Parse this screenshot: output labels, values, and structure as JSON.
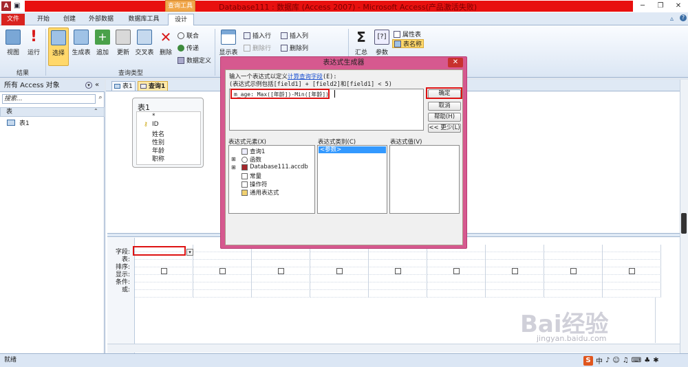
{
  "title_bar": {
    "context_tab": "查询工具",
    "window_title": "Database111 : 数据库 (Access 2007) - Microsoft Access(产品激活失败)"
  },
  "tabs": [
    "文件",
    "开始",
    "创建",
    "外部数据",
    "数据库工具",
    "设计"
  ],
  "ribbon": {
    "results_group": {
      "label": "结果",
      "view": "视图",
      "run": "运行"
    },
    "query_type_group": {
      "label": "查询类型",
      "select": "选择",
      "make_table": "生成表",
      "append": "追加",
      "update": "更新",
      "crosstab": "交叉表",
      "delete": "删除",
      "union": "联合",
      "pass_through": "传递",
      "data_definition": "数据定义"
    },
    "show_table": "显示表",
    "insert_row": "插入行",
    "delete_row": "删除行",
    "insert_col": "插入列",
    "delete_col": "删除列",
    "totals": "汇总",
    "parameters": "参数",
    "property_sheet": "属性表",
    "table_names": "表名称"
  },
  "nav": {
    "header": "所有 Access 对象",
    "search_placeholder": "搜索...",
    "section": "表",
    "items": [
      "表1"
    ]
  },
  "doc_tabs": [
    "表1",
    "查询1"
  ],
  "table_box": {
    "title": "表1",
    "fields": [
      "*",
      "ID",
      "姓名",
      "性别",
      "年龄",
      "职称"
    ]
  },
  "grid": {
    "row_labels": [
      "字段:",
      "表:",
      "排序:",
      "显示:",
      "条件:",
      "或:"
    ]
  },
  "dialog": {
    "title": "表达式生成器",
    "instruction_prefix": "输入一个表达式以定义",
    "instruction_link": "计算查询字段",
    "instruction_suffix": "(E):",
    "example": "(表达式示例包括[field1] + [field2]和[field1] < 5)",
    "expression": "m_age: Max([年龄])-Min([年龄])",
    "buttons": {
      "ok": "确定",
      "cancel": "取消",
      "help": "帮助(H)",
      "less": "<< 更少(L)"
    },
    "elements_label": "表达式元素(X)",
    "categories_label": "表达式类别(C)",
    "values_label": "表达式值(V)",
    "elements": [
      "查询1",
      "函数",
      "Database111.accdb",
      "常量",
      "操作符",
      "通用表达式"
    ],
    "categories": [
      "<参数>"
    ]
  },
  "status": {
    "text": "就绪"
  },
  "ime": {
    "label": "中"
  },
  "watermark": {
    "text": "Bai经验",
    "url": "jingyan.baidu.com"
  },
  "colors": {
    "accent_red": "#e8100f",
    "dialog_frame": "#d6598f",
    "annotation_red": "#dd1111"
  }
}
